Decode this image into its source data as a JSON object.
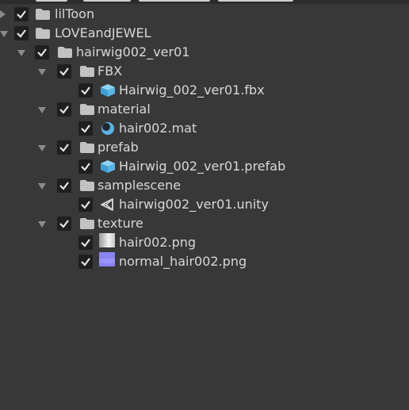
{
  "tree": [
    {
      "label": "lilToon",
      "icon": "folder-icon",
      "checked": true,
      "expanded": false
    },
    {
      "label": "LOVEandJEWEL",
      "icon": "folder-icon",
      "checked": true,
      "expanded": true
    },
    {
      "label": "hairwig002_ver01",
      "icon": "folder-icon",
      "checked": true,
      "expanded": true
    },
    {
      "label": "FBX",
      "icon": "folder-icon",
      "checked": true,
      "expanded": true
    },
    {
      "label": "Hairwig_002_ver01.fbx",
      "icon": "model-cube-icon",
      "checked": true
    },
    {
      "label": "material",
      "icon": "folder-icon",
      "checked": true,
      "expanded": true
    },
    {
      "label": "hair002.mat",
      "icon": "material-sphere-icon",
      "checked": true
    },
    {
      "label": "prefab",
      "icon": "folder-icon",
      "checked": true,
      "expanded": true
    },
    {
      "label": "Hairwig_002_ver01.prefab",
      "icon": "prefab-cube-icon",
      "checked": true
    },
    {
      "label": "samplescene",
      "icon": "folder-icon",
      "checked": true,
      "expanded": true
    },
    {
      "label": "hairwig002_ver01.unity",
      "icon": "unity-scene-icon",
      "checked": true
    },
    {
      "label": "texture",
      "icon": "folder-icon",
      "checked": true,
      "expanded": true
    },
    {
      "label": "hair002.png",
      "icon": "texture-thumbnail-icon",
      "checked": true
    },
    {
      "label": "normal_hair002.png",
      "icon": "normal-map-thumbnail-icon",
      "checked": true
    }
  ],
  "colors": {
    "background": "#383838",
    "checkbox": "#1f1f1f",
    "text": "#d8d8d8",
    "folder": "#c2c2c2",
    "asset_blue": "#5ab4e6",
    "normal_map": "#8080ff"
  }
}
